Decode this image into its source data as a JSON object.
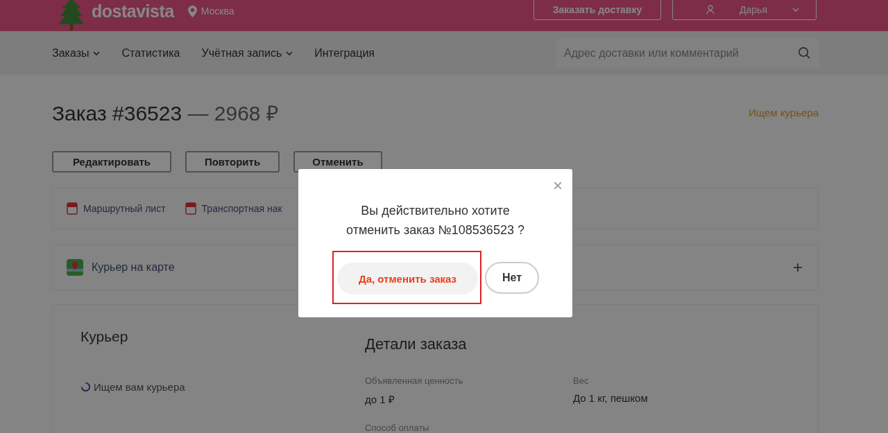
{
  "header": {
    "logo": "dostavista",
    "city": "Москва",
    "order_button": "Заказать доставку",
    "user": "Дарья"
  },
  "nav": {
    "items": [
      {
        "label": "Заказы",
        "dropdown": true
      },
      {
        "label": "Статистика",
        "dropdown": false
      },
      {
        "label": "Учётная запись",
        "dropdown": true
      },
      {
        "label": "Интеграция",
        "dropdown": false
      }
    ],
    "search": {
      "placeholder": "Адрес доставки или комментарий"
    }
  },
  "order": {
    "title": "Заказ #36523",
    "price": "— 2968 ₽",
    "status": "Ищем курьера",
    "actions": [
      "Редактировать",
      "Повторить",
      "Отменить"
    ],
    "documents": [
      "Маршрутный лист",
      "Транспортная нак"
    ],
    "map_panel": {
      "label": "Курьер на карте",
      "expand": "+"
    },
    "courier": {
      "heading": "Курьер",
      "status": "Ищем вам курьера"
    },
    "details": {
      "heading": "Детали заказа",
      "fields": [
        {
          "label": "Объявленная ценность",
          "value": "до 1 ₽"
        },
        {
          "label": "Вес",
          "value": "До 1 кг, пешком"
        },
        {
          "label": "Способ оплаты"
        }
      ]
    }
  },
  "modal": {
    "close": "×",
    "message": "Вы действительно хотите отменить заказ №108536523 ?",
    "confirm": {
      "label": "Да, отменить заказ",
      "highlighted": true
    },
    "cancel": "Нет"
  }
}
